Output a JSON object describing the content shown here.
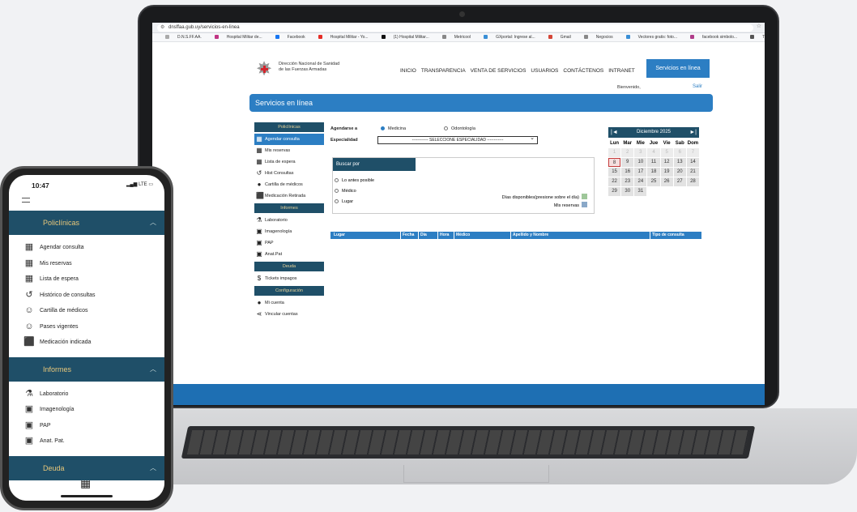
{
  "browser": {
    "url": "dnsffaa.gub.uy/servicios-en-linea",
    "bookmarks": [
      "D.N.S.FF.AA.",
      "Hospital Militar de...",
      "Facebook",
      "Hospital Militar - Yo...",
      "(1) Hospital Militar...",
      "Metricool",
      "GXportal: Ingrese al...",
      "Gmail",
      "Negocios",
      "Vectores gratis: foto...",
      "facebook simbolo...",
      "Trabajar con Tareas"
    ],
    "bookmark_colors": [
      "#aaa",
      "#c13584",
      "#1877f2",
      "#e52d27",
      "#111",
      "#888",
      "#3a8fd6",
      "#d44638",
      "#888",
      "#3a8fd6",
      "#b03d8a",
      "#555"
    ]
  },
  "site": {
    "logo_line1": "Dirección Nacional de Sanidad",
    "logo_line2": "de las Fuerzas Armadas",
    "nav": [
      "INICIO",
      "TRANSPARENCIA",
      "VENTA DE SERVICIOS",
      "USUARIOS",
      "CONTÁCTENOS",
      "INTRANET"
    ],
    "services_button": "Servicios en línea",
    "welcome": "Bienvenido,",
    "exit": "Salir",
    "banner_title": "Servicios en línea"
  },
  "sidebar": {
    "sections": [
      {
        "title": "Policlínicas",
        "items": [
          {
            "label": "Agendar consulta",
            "icon": "calendar-icon",
            "glyph": "▦",
            "active": true
          },
          {
            "label": "Mis reservas",
            "icon": "reservations-icon",
            "glyph": "▦",
            "active": false
          },
          {
            "label": "Lista de espera",
            "icon": "waitlist-icon",
            "glyph": "▦",
            "active": false
          },
          {
            "label": "Hist Consultas",
            "icon": "history-icon",
            "glyph": "↺",
            "active": false
          },
          {
            "label": "Cartilla de médicos",
            "icon": "doctor-icon",
            "glyph": "●",
            "active": false
          },
          {
            "label": "Medicación Retirada",
            "icon": "medication-icon",
            "glyph": "⬛",
            "active": false
          }
        ]
      },
      {
        "title": "Informes",
        "items": [
          {
            "label": "Laboratorio",
            "icon": "lab-icon",
            "glyph": "⚗",
            "active": false
          },
          {
            "label": "Imagenología",
            "icon": "xray-icon",
            "glyph": "▣",
            "active": false
          },
          {
            "label": "PAP",
            "icon": "xray-icon",
            "glyph": "▣",
            "active": false
          },
          {
            "label": "Anat.Pat",
            "icon": "xray-icon",
            "glyph": "▣",
            "active": false
          }
        ]
      },
      {
        "title": "Deuda",
        "items": [
          {
            "label": "Tickets impagos",
            "icon": "ticket-icon",
            "glyph": "$",
            "active": false
          }
        ]
      },
      {
        "title": "Configuración",
        "items": [
          {
            "label": "Mi cuenta",
            "icon": "user-icon",
            "glyph": "●",
            "active": false
          },
          {
            "label": "Vincular cuentas",
            "icon": "share-icon",
            "glyph": "⋖",
            "active": false
          }
        ]
      }
    ]
  },
  "form": {
    "agendarse_label": "Agendarse a",
    "option_medicina": "Medicina",
    "option_odontologia": "Odontología",
    "especialidad_label": "Especialidad",
    "especialidad_value": "------------ SELECCIONE ESPECIALIDAD ------------",
    "buscar_title": "Buscar por",
    "buscar_options": [
      "Lo antes posible",
      "Médico",
      "Lugar"
    ],
    "dias_disponibles": "Días disponibles(presione sobre el día)",
    "mis_reservas": "Mis reservas",
    "color_disponibles": "#9fc79a",
    "color_reservas": "#8aa8c8"
  },
  "calendar": {
    "title": "Diciembre 2025",
    "prev": "|◄",
    "next": "►|",
    "weekdays": [
      "Lun",
      "Mar",
      "Mie",
      "Jue",
      "Vie",
      "Sab",
      "Dom"
    ],
    "weeks": [
      [
        "1",
        "2",
        "3",
        "4",
        "5",
        "6",
        "7"
      ],
      [
        "8",
        "9",
        "10",
        "11",
        "12",
        "13",
        "14"
      ],
      [
        "15",
        "16",
        "17",
        "18",
        "19",
        "20",
        "21"
      ],
      [
        "22",
        "23",
        "24",
        "25",
        "26",
        "27",
        "28"
      ],
      [
        "29",
        "30",
        "31",
        "",
        "",
        "",
        ""
      ]
    ],
    "today": "8",
    "past_days": [
      "1",
      "2",
      "3",
      "4",
      "5",
      "6",
      "7"
    ]
  },
  "results": {
    "columns": [
      "Lugar",
      "Fecha",
      "Día",
      "Hora",
      "Médico",
      "Apellido y Nombre",
      "Tipo de consulta"
    ]
  },
  "phone": {
    "time": "10:47",
    "signal": "LTE",
    "sections": [
      {
        "title": "Policlínicas",
        "items": [
          {
            "label": "Agendar consulta",
            "icon": "calendar-icon",
            "glyph": "▦"
          },
          {
            "label": "Mis reservas",
            "icon": "reservations-icon",
            "glyph": "▦"
          },
          {
            "label": "Lista de espera",
            "icon": "waitlist-icon",
            "glyph": "▦"
          },
          {
            "label": "Histórico de consultas",
            "icon": "history-icon",
            "glyph": "↺"
          },
          {
            "label": "Cartilla de médicos",
            "icon": "doctor-icon",
            "glyph": "☺"
          },
          {
            "label": "Pases vigentes",
            "icon": "pass-icon",
            "glyph": "☺"
          },
          {
            "label": "Medicación indicada",
            "icon": "medication-icon",
            "glyph": "⬛"
          }
        ]
      },
      {
        "title": "Informes",
        "items": [
          {
            "label": "Laboratorio",
            "icon": "lab-icon",
            "glyph": "⚗"
          },
          {
            "label": "Imagenología",
            "icon": "xray-icon",
            "glyph": "▣"
          },
          {
            "label": "PAP",
            "icon": "xray-icon",
            "glyph": "▣"
          },
          {
            "label": "Anat. Pat.",
            "icon": "xray-icon",
            "glyph": "▣"
          }
        ]
      },
      {
        "title": "Deuda",
        "items": []
      }
    ]
  }
}
